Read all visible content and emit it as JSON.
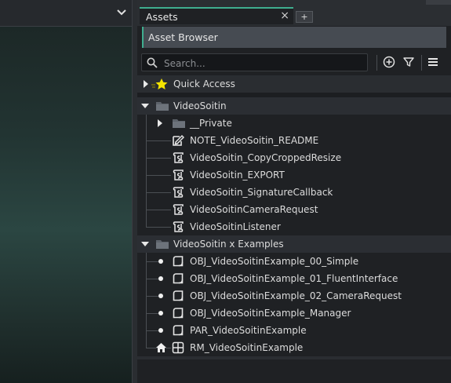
{
  "tab": {
    "label": "Assets",
    "close": "×",
    "add": "+"
  },
  "browser": {
    "title": "Asset Browser"
  },
  "search": {
    "placeholder": "Search..."
  },
  "quick_access": {
    "label": "Quick Access"
  },
  "groups": [
    {
      "label": "VideoSoitin",
      "items": [
        {
          "label": "__Private",
          "kind": "folder"
        },
        {
          "label": "NOTE_VideoSoitin_README",
          "kind": "note"
        },
        {
          "label": "VideoSoitin_CopyCroppedResize",
          "kind": "script"
        },
        {
          "label": "VideoSoitin_EXPORT",
          "kind": "script"
        },
        {
          "label": "VideoSoitin_SignatureCallback",
          "kind": "script"
        },
        {
          "label": "VideoSoitinCameraRequest",
          "kind": "script"
        },
        {
          "label": "VideoSoitinListener",
          "kind": "script"
        }
      ]
    },
    {
      "label": "VideoSoitin x Examples",
      "items": [
        {
          "label": "OBJ_VideoSoitinExample_00_Simple",
          "kind": "object"
        },
        {
          "label": "OBJ_VideoSoitinExample_01_FluentInterface",
          "kind": "object"
        },
        {
          "label": "OBJ_VideoSoitinExample_02_CameraRequest",
          "kind": "object"
        },
        {
          "label": "OBJ_VideoSoitinExample_Manager",
          "kind": "object"
        },
        {
          "label": "PAR_VideoSoitinExample",
          "kind": "object"
        },
        {
          "label": "RM_VideoSoitinExample",
          "kind": "room"
        }
      ]
    }
  ],
  "icons": {
    "collapse": "chevron-down-icon",
    "close": "close-icon",
    "search": "search-icon",
    "create": "plus-circle-icon",
    "filter": "filter-icon",
    "menu": "hamburger-menu-icon",
    "quick_access": "star-icon",
    "folder": "folder-icon",
    "note": "note-icon",
    "script": "script-icon",
    "object": "object-icon",
    "room": "room-icon",
    "home": "home-icon"
  },
  "colors": {
    "accent": "#3fae8f",
    "star": "#f5e400",
    "panel": "#1f2124",
    "header": "#464b52"
  }
}
